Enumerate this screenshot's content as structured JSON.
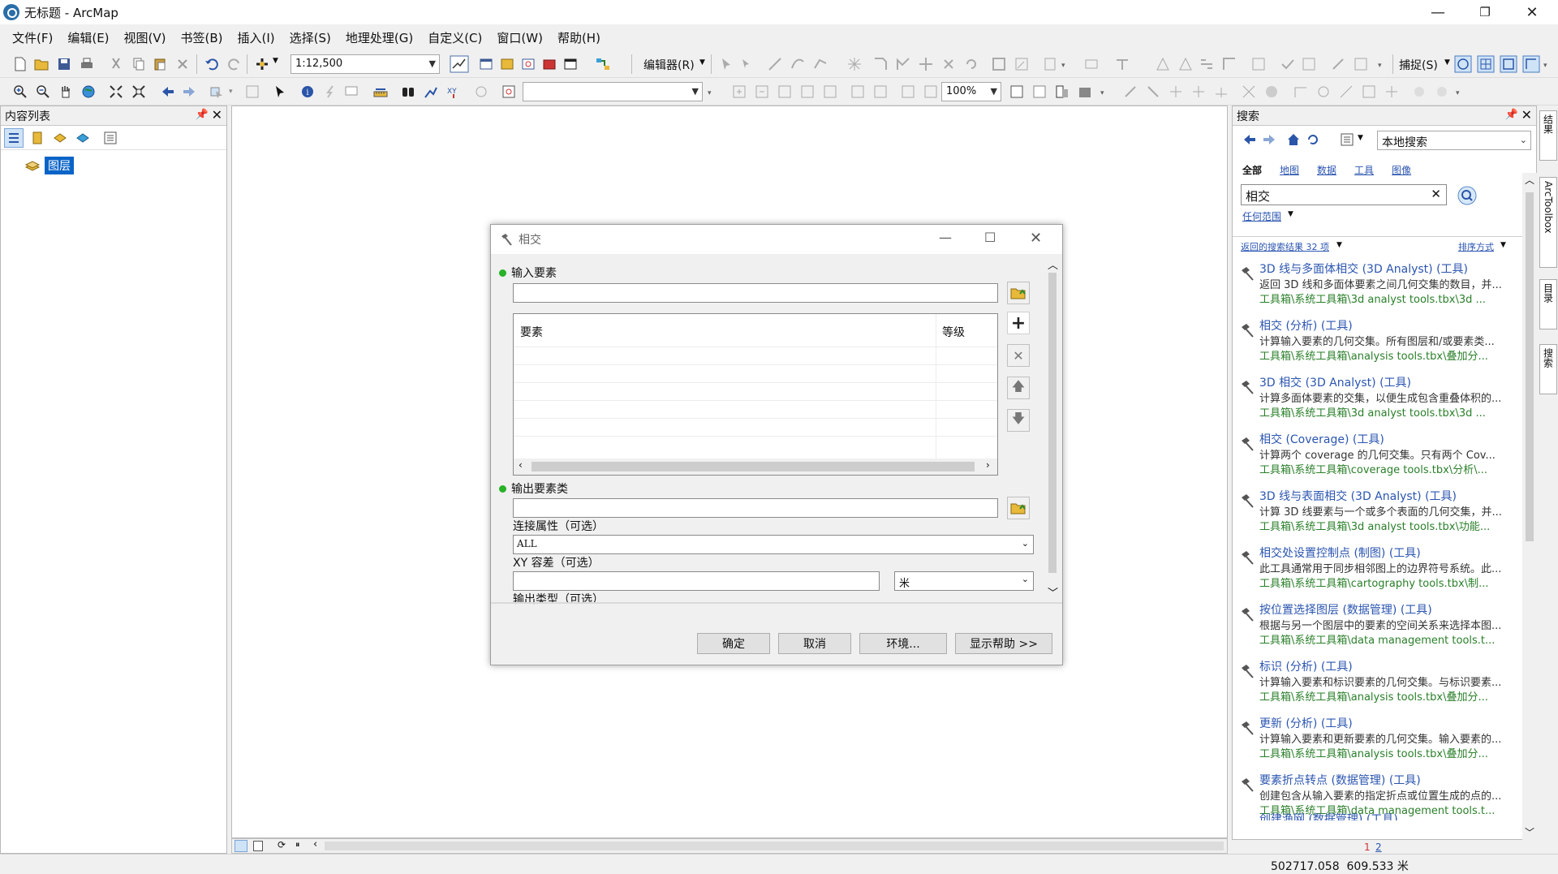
{
  "window": {
    "title": "无标题 - ArcMap"
  },
  "menu": [
    "文件(F)",
    "编辑(E)",
    "视图(V)",
    "书签(B)",
    "插入(I)",
    "选择(S)",
    "地理处理(G)",
    "自定义(C)",
    "窗口(W)",
    "帮助(H)"
  ],
  "toolbar": {
    "scale": "1:12,500",
    "editor": "编辑器(R)",
    "snap": "捕捉(S)",
    "zoom": "100%"
  },
  "toc": {
    "title": "内容列表",
    "layers_label": "图层"
  },
  "dialog": {
    "title": "相交",
    "input_label": "输入要素",
    "grid_col_features": "要素",
    "grid_col_rank": "等级",
    "output_label": "输出要素类",
    "join_label": "连接属性（可选）",
    "join_value": "ALL",
    "xy_label": "XY 容差（可选）",
    "xy_unit": "米",
    "output_type_label": "输出类型（可选）",
    "buttons": {
      "ok": "确定",
      "cancel": "取消",
      "env": "环境...",
      "help": "显示帮助 >>"
    }
  },
  "search": {
    "title": "搜索",
    "scope": "本地搜索",
    "filters": [
      "全部",
      "地图",
      "数据",
      "工具",
      "图像"
    ],
    "query": "相交",
    "range_label": "任何范围",
    "results_count": "返回的搜索结果 32 项",
    "sort_label": "排序方式",
    "results": [
      {
        "title": "3D 线与多面体相交 (3D Analyst) (工具)",
        "desc": "返回 3D 线和多面体要素之间几何交集的数目，并...",
        "path": "工具箱\\系统工具箱\\3d analyst tools.tbx\\3d ..."
      },
      {
        "title": "相交 (分析) (工具)",
        "desc": "计算输入要素的几何交集。所有图层和/或要素类...",
        "path": "工具箱\\系统工具箱\\analysis tools.tbx\\叠加分..."
      },
      {
        "title": "3D 相交 (3D Analyst) (工具)",
        "desc": "计算多面体要素的交集，以便生成包含重叠体积的...",
        "path": "工具箱\\系统工具箱\\3d analyst tools.tbx\\3d ..."
      },
      {
        "title": "相交 (Coverage) (工具)",
        "desc": "计算两个 coverage 的几何交集。只有两个 Cov...",
        "path": "工具箱\\系统工具箱\\coverage tools.tbx\\分析\\..."
      },
      {
        "title": "3D 线与表面相交 (3D Analyst) (工具)",
        "desc": "计算 3D 线要素与一个或多个表面的几何交集，并...",
        "path": "工具箱\\系统工具箱\\3d analyst tools.tbx\\功能..."
      },
      {
        "title": "相交处设置控制点 (制图) (工具)",
        "desc": "此工具通常用于同步相邻图上的边界符号系统。此...",
        "path": "工具箱\\系统工具箱\\cartography tools.tbx\\制..."
      },
      {
        "title": "按位置选择图层 (数据管理) (工具)",
        "desc": "根据与另一个图层中的要素的空间关系来选择本图...",
        "path": "工具箱\\系统工具箱\\data management tools.t..."
      },
      {
        "title": "标识 (分析) (工具)",
        "desc": "计算输入要素和标识要素的几何交集。与标识要素...",
        "path": "工具箱\\系统工具箱\\analysis tools.tbx\\叠加分..."
      },
      {
        "title": "更新 (分析) (工具)",
        "desc": "计算输入要素和更新要素的几何交集。输入要素的...",
        "path": "工具箱\\系统工具箱\\analysis tools.tbx\\叠加分..."
      },
      {
        "title": "要素折点转点 (数据管理) (工具)",
        "desc": "创建包含从输入要素的指定折点或位置生成的点的...",
        "path": "工具箱\\系统工具箱\\data management tools.t..."
      },
      {
        "title": "创建渔网 (数据管理) (工具)",
        "desc": "",
        "path": ""
      }
    ],
    "pages": [
      "1",
      "2"
    ]
  },
  "right_tabs": [
    "结果",
    "ArcToolbox",
    "目录",
    "搜索"
  ],
  "status": {
    "coords": "502717.058  609.533 米"
  },
  "colors": {
    "link": "#2b55b0",
    "path": "#2a7f2a",
    "required_dot": "#27b227",
    "selected": "#0a64c8"
  }
}
